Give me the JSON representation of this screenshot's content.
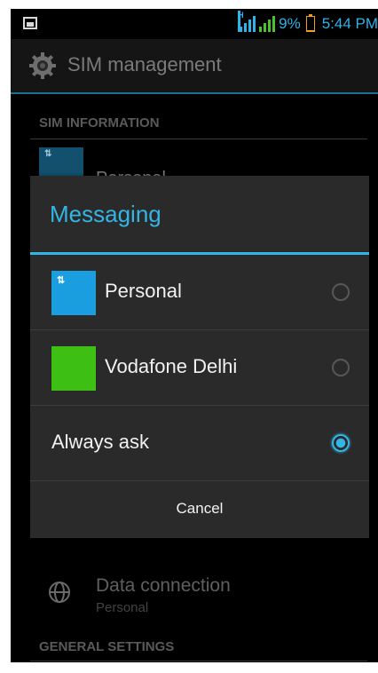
{
  "status_bar": {
    "battery_percent": "9%",
    "battery_level": 0.09,
    "time": "5:44 PM",
    "network_type": "H",
    "accent_color": "#2fb3e8",
    "signal_green": "#4cc22a"
  },
  "action_bar": {
    "title": "SIM management",
    "icon": "gear-icon"
  },
  "sections": {
    "sim_information": "SIM INFORMATION",
    "general_settings": "GENERAL SETTINGS"
  },
  "sim_list": {
    "first_sim_label": "Personal",
    "first_sim_toggle": "ON"
  },
  "data_connection": {
    "title": "Data connection",
    "subtitle": "Personal",
    "icon": "globe-icon"
  },
  "dialog": {
    "title": "Messaging",
    "title_color": "#33b5e5",
    "options": [
      {
        "label": "Personal",
        "color": "#1a9ee0",
        "selected": false
      },
      {
        "label": "Vodafone Delhi",
        "color": "#3dbf14",
        "selected": false
      },
      {
        "label": "Always ask",
        "selected": true
      }
    ],
    "cancel_label": "Cancel"
  }
}
